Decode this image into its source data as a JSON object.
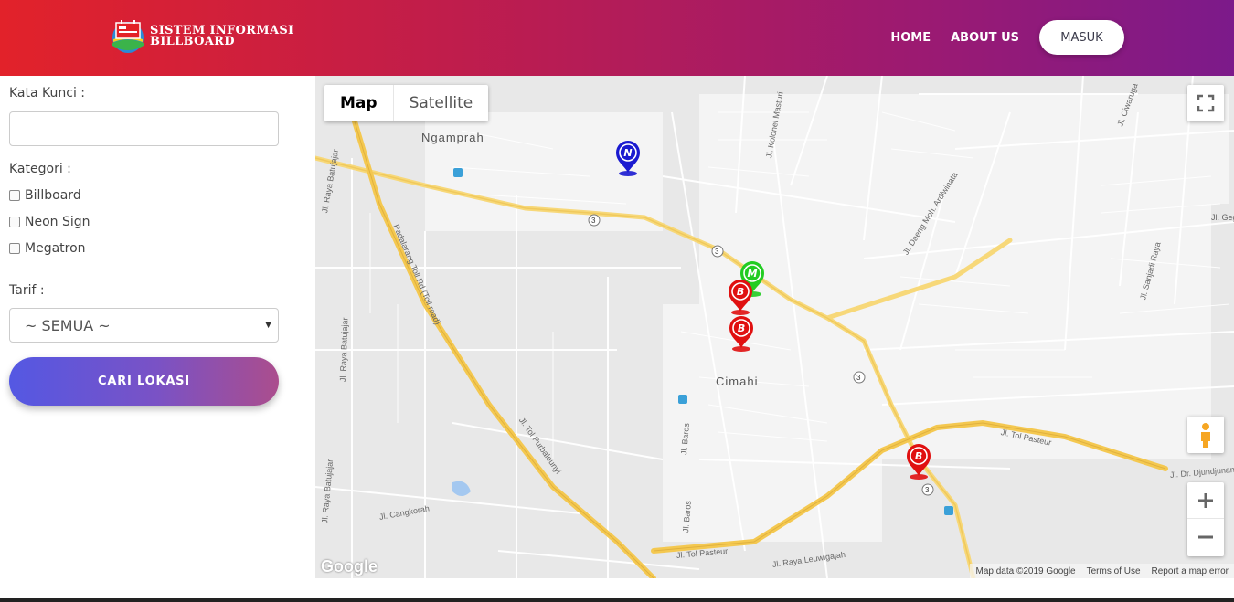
{
  "header": {
    "logo_line1": "SISTEM INFORMASI",
    "logo_line2": "BILLBOARD",
    "nav": [
      "HOME",
      "ABOUT US"
    ],
    "login_label": "MASUK",
    "gradient_colors": [
      "#e2222a",
      "#7c1a8a"
    ]
  },
  "filters": {
    "keyword_label": "Kata Kunci :",
    "keyword_value": "",
    "category_label": "Kategori :",
    "categories": [
      "Billboard",
      "Neon Sign",
      "Megatron"
    ],
    "tariff_label": "Tarif :",
    "tariff_selected": "~ SEMUA ~",
    "search_button": "CARI LOKASI"
  },
  "map": {
    "map_type_options": [
      "Map",
      "Satellite"
    ],
    "selected_map_type": "Map",
    "places": [
      "Ngamprah",
      "Cimahi"
    ],
    "roads": [
      "Padalarang Toll Rd (Toll road)",
      "Jl. Tol Purbaleunyi",
      "Jl. Tol Pasteur",
      "Jl. Tol Pasteur",
      "Jl. Baros",
      "Jl. Baros",
      "Jl. Kolonel Masturi",
      "Jl. Daeng Moh. Ardiwinata",
      "Jl. Sanjadi Raya",
      "Jl. Ciwaruga",
      "Jl. Raya Batujajar",
      "Jl. Raya Batujajar",
      "Jl. Raya Batujajar",
      "Jl. Cangkorah",
      "Jl. Raya Leuwigajah",
      "Jl. Dr. Djundjunan",
      "Jl. Geg"
    ],
    "route_shield": "3",
    "markers": [
      {
        "letter": "N",
        "type": "Neon Sign",
        "color": "#1a1ad0"
      },
      {
        "letter": "M",
        "type": "Megatron",
        "color": "#22cc22"
      },
      {
        "letter": "B",
        "type": "Billboard",
        "color": "#e01010"
      },
      {
        "letter": "B",
        "type": "Billboard",
        "color": "#e01010"
      },
      {
        "letter": "B",
        "type": "Billboard",
        "color": "#e01010"
      }
    ],
    "google_logo": "Google",
    "attribution": [
      "Map data ©2019 Google",
      "Terms of Use",
      "Report a map error"
    ]
  }
}
